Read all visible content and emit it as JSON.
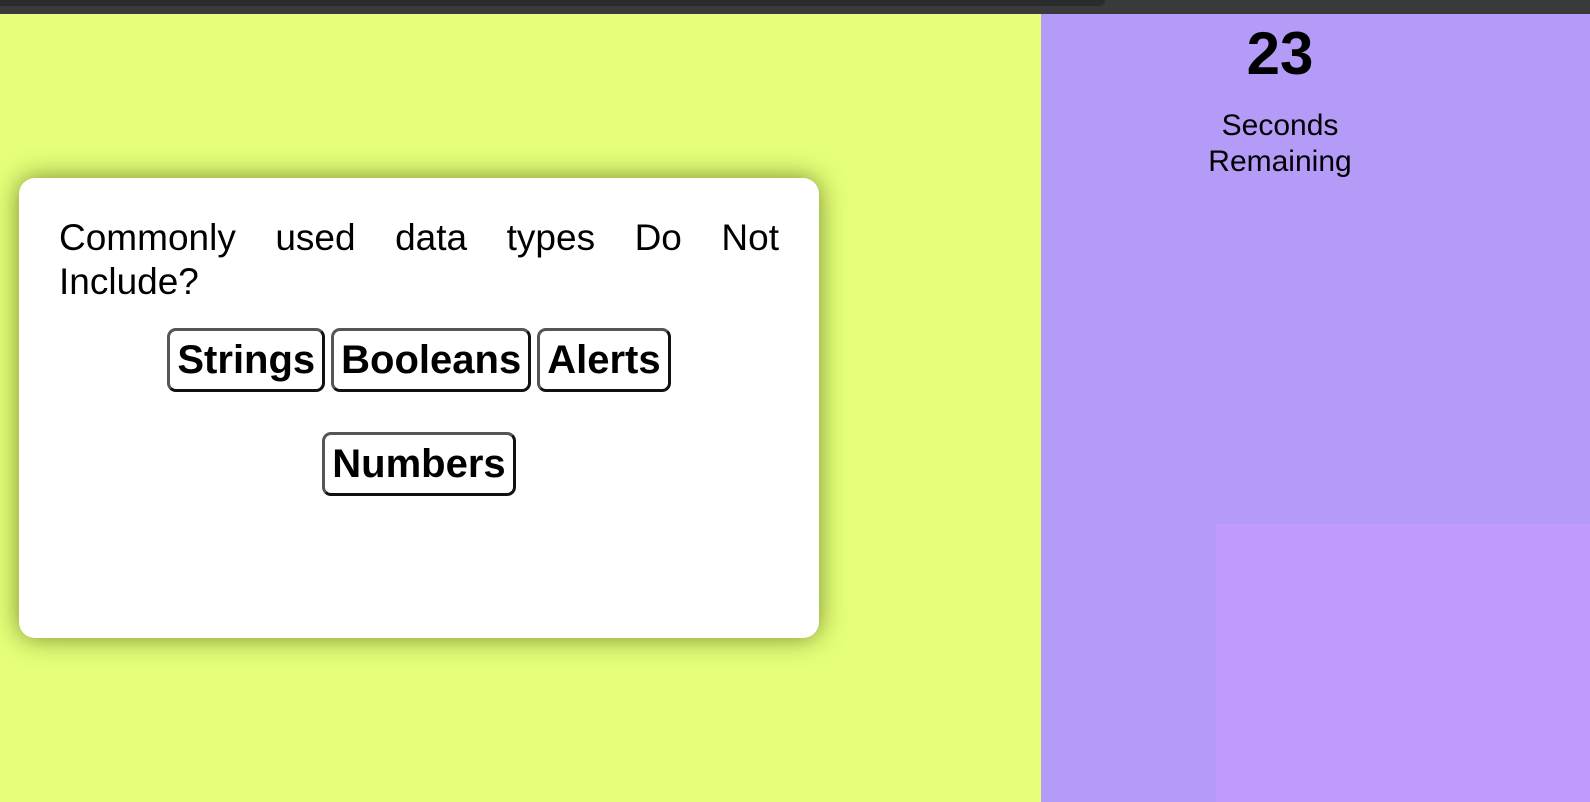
{
  "timer": {
    "count": "23",
    "label": "Seconds Remaining"
  },
  "quiz": {
    "question": "Commonly used data types Do Not Include?",
    "answers": [
      "Strings",
      "Booleans",
      "Alerts",
      "Numbers"
    ]
  },
  "colors": {
    "left_background": "#e5ff7a",
    "right_background": "#b49bf7",
    "right_inner_block": "#c19bfc",
    "card_background": "#ffffff"
  }
}
